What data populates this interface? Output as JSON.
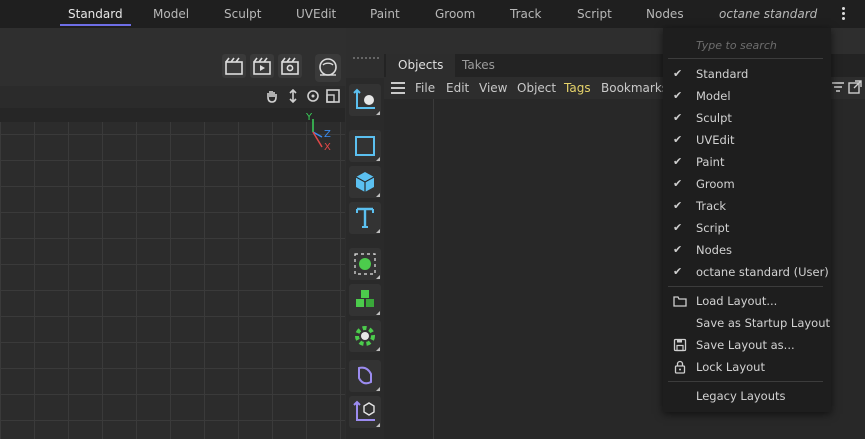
{
  "layout_bar": {
    "tabs": [
      {
        "label": "Standard",
        "active": true
      },
      {
        "label": "Model"
      },
      {
        "label": "Sculpt"
      },
      {
        "label": "UVEdit"
      },
      {
        "label": "Paint"
      },
      {
        "label": "Groom"
      },
      {
        "label": "Track"
      },
      {
        "label": "Script"
      },
      {
        "label": "Nodes"
      },
      {
        "label": "octane standard",
        "italic": true
      }
    ],
    "more_icon": "vertical-ellipsis-icon"
  },
  "scene_buttons": [
    "render-settings-icon",
    "render-view-icon",
    "render-picture-viewer-icon"
  ],
  "viewport": {
    "axis_labels": {
      "y": "Y",
      "z": "Z",
      "x": "X"
    },
    "header_icons": [
      "pan-hand-icon",
      "move-arrows-icon",
      "rotate-icon",
      "maximize-icon"
    ]
  },
  "tool_strip": [
    "coordinate-system-icon",
    "cube-outline-icon",
    "cube-icon",
    "text-icon",
    "selection-icon",
    "cloner-icon",
    "generator-icon",
    "deformer-icon",
    "null-object-icon"
  ],
  "objects_panel": {
    "tabs": [
      {
        "label": "Objects",
        "active": true
      },
      {
        "label": "Takes"
      }
    ],
    "menu": [
      "File",
      "Edit",
      "View",
      "Object",
      "Tags",
      "Bookmarks"
    ]
  },
  "dropdown": {
    "search_placeholder": "Type to search",
    "layouts": [
      {
        "label": "Standard",
        "checked": true
      },
      {
        "label": "Model",
        "checked": true
      },
      {
        "label": "Sculpt",
        "checked": true
      },
      {
        "label": "UVEdit",
        "checked": true
      },
      {
        "label": "Paint",
        "checked": true
      },
      {
        "label": "Groom",
        "checked": true
      },
      {
        "label": "Track",
        "checked": true
      },
      {
        "label": "Script",
        "checked": true
      },
      {
        "label": "Nodes",
        "checked": true
      },
      {
        "label": "octane standard (User)",
        "checked": true
      }
    ],
    "actions": [
      {
        "label": "Load Layout...",
        "icon": "folder-icon"
      },
      {
        "label": "Save as Startup Layout",
        "icon": ""
      },
      {
        "label": "Save Layout as...",
        "icon": "save-icon"
      },
      {
        "label": "Lock Layout",
        "icon": "lock-icon"
      }
    ],
    "legacy": "Legacy Layouts"
  },
  "colors": {
    "active_underline": "#6e6ee6",
    "tags_menu": "#e6d36a",
    "axis_y": "#3ad25a",
    "axis_z": "#3a8cf0",
    "axis_x": "#e04848",
    "tool_blue": "#5bc0f0",
    "tool_green": "#4ccc4c",
    "tool_purple": "#9c8cf0"
  }
}
